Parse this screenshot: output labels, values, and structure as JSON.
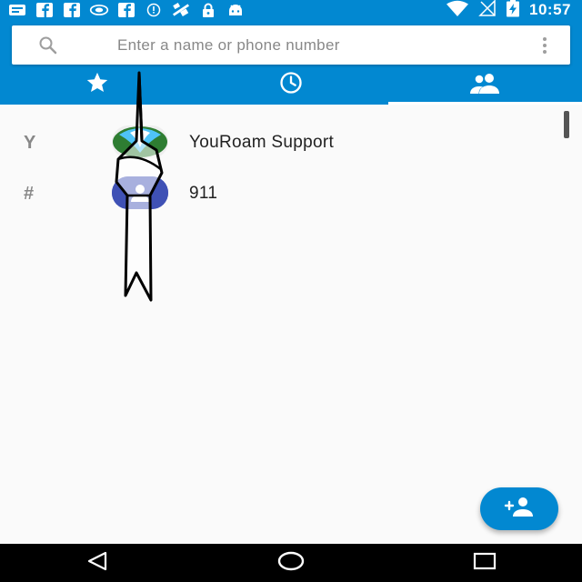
{
  "status_bar": {
    "time": "10:57",
    "icons": [
      "message-icon",
      "facebook-icon",
      "facebook-icon",
      "nvidia-icon",
      "facebook-icon",
      "info-icon",
      "satellite-icon",
      "lock-icon",
      "android-icon",
      "wifi-icon",
      "no-signal-icon",
      "battery-charging-icon"
    ]
  },
  "search": {
    "placeholder": "Enter a name or phone number"
  },
  "tabs": [
    {
      "name": "favorites",
      "icon": "star-icon",
      "selected": false
    },
    {
      "name": "recents",
      "icon": "clock-icon",
      "selected": false
    },
    {
      "name": "contacts",
      "icon": "people-icon",
      "selected": true
    }
  ],
  "contacts": [
    {
      "section": "Y",
      "name": "YouRoam Support",
      "avatar": "logo"
    },
    {
      "section": "#",
      "name": "911",
      "avatar": "default"
    }
  ],
  "colors": {
    "primary": "#0288d1",
    "avatar_default": "#3f51b5",
    "background": "#fafafa"
  },
  "fab": {
    "icon": "add-contact-icon"
  },
  "nav": [
    "back-icon",
    "home-icon",
    "recents-icon"
  ]
}
